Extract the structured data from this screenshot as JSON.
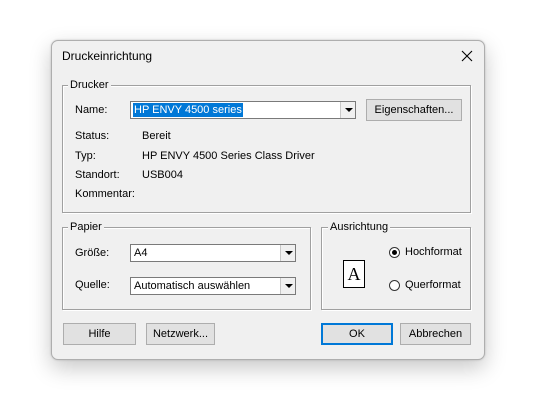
{
  "window": {
    "title": "Druckeinrichtung",
    "close_icon": "close-icon"
  },
  "printer": {
    "legend": "Drucker",
    "name_label": "Name:",
    "name_value": "HP ENVY 4500 series",
    "properties_button": "Eigenschaften...",
    "status_label": "Status:",
    "status_value": "Bereit",
    "type_label": "Typ:",
    "type_value": "HP ENVY 4500 Series Class Driver",
    "location_label": "Standort:",
    "location_value": "USB004",
    "comment_label": "Kommentar:",
    "comment_value": ""
  },
  "paper": {
    "legend": "Papier",
    "size_label": "Größe:",
    "size_value": "A4",
    "source_label": "Quelle:",
    "source_value": "Automatisch auswählen"
  },
  "orientation": {
    "legend": "Ausrichtung",
    "icon_letter": "A",
    "options": [
      {
        "label": "Hochformat",
        "checked": true
      },
      {
        "label": "Querformat",
        "checked": false
      }
    ]
  },
  "buttons": {
    "help": "Hilfe",
    "network": "Netzwerk...",
    "ok": "OK",
    "cancel": "Abbrechen"
  },
  "colors": {
    "accent": "#0078d7",
    "dialog_bg": "#f0f0f0"
  }
}
